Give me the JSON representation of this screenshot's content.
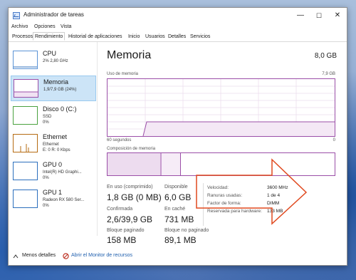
{
  "window": {
    "title": "Administrador de tareas",
    "controls": {
      "minimize": "—",
      "maximize": "☐",
      "close": "✕"
    }
  },
  "menu": [
    "Archivo",
    "Opciones",
    "Vista"
  ],
  "tabs": [
    "Procesos",
    "Rendimiento",
    "Historial de aplicaciones",
    "Inicio",
    "Usuarios",
    "Detalles",
    "Servicios"
  ],
  "active_tab": "Rendimiento",
  "sidebar": {
    "items": [
      {
        "name": "CPU",
        "sub1": "2% 2,80 GHz",
        "sub2": ""
      },
      {
        "name": "Memoria",
        "sub1": "1,9/7,9 GB (24%)",
        "sub2": ""
      },
      {
        "name": "Disco 0 (C:)",
        "sub1": "SSD",
        "sub2": "0%"
      },
      {
        "name": "Ethernet",
        "sub1": "Ethernet",
        "sub2": "E: 0 R: 0 Kbps"
      },
      {
        "name": "GPU 0",
        "sub1": "Intel(R) HD Graphi...",
        "sub2": "0%"
      },
      {
        "name": "GPU 1",
        "sub1": "Radeon RX 580 Ser...",
        "sub2": "0%"
      }
    ]
  },
  "main": {
    "title": "Memoria",
    "total": "8,0 GB",
    "usage_label": "Uso de memoria",
    "usage_max": "7,9 GB",
    "axis_left": "60 segundos",
    "axis_right": "0",
    "composition_label": "Composición de memoria",
    "stats": {
      "in_use_label": "En uso (comprimido)",
      "in_use": "1,8 GB (0 MB)",
      "available_label": "Disponible",
      "available": "6,0 GB",
      "committed_label": "Confirmada",
      "committed": "2,6/39,9 GB",
      "cached_label": "En caché",
      "cached": "731 MB",
      "paged_label": "Bloque paginado",
      "paged": "158 MB",
      "nonpaged_label": "Bloque no paginado",
      "nonpaged": "89,1 MB"
    },
    "details": [
      {
        "label": "Velocidad:",
        "value": "3600 MHz"
      },
      {
        "label": "Ranuras usadas:",
        "value": "1 de 4"
      },
      {
        "label": "Factor de forma:",
        "value": "DIMM"
      },
      {
        "label": "Reservada para hardware:",
        "value": "133 MB"
      }
    ]
  },
  "footer": {
    "less_details": "Menos detalles",
    "resource_monitor": "Abrir el Monitor de recursos"
  },
  "colors": {
    "memory": "#9b4fa8",
    "disk": "#4aa13f",
    "ethernet": "#b56b12",
    "gpu": "#2c6fbd",
    "cpu": "#2c6fbd",
    "arrow": "#e0491f"
  },
  "icons": [
    "task-manager-app-icon",
    "chevron-up-icon",
    "resource-monitor-icon"
  ]
}
